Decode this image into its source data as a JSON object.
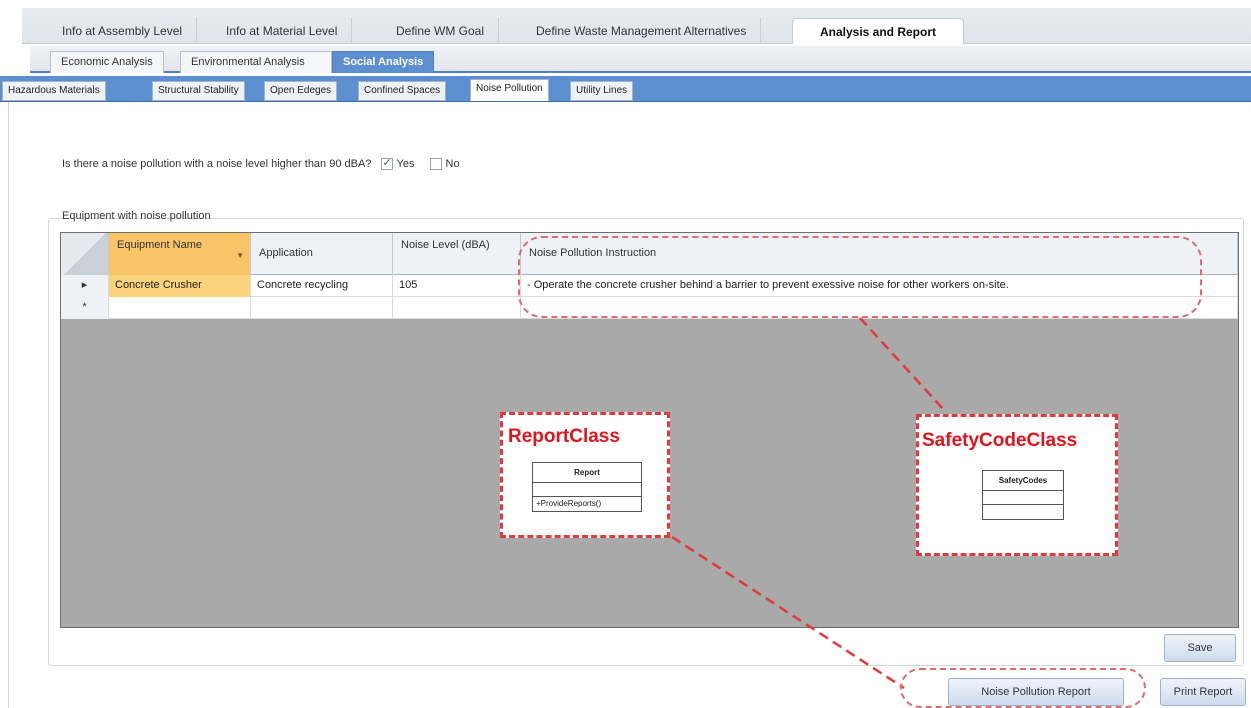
{
  "top_tabs": [
    {
      "label": "Info at Assembly Level"
    },
    {
      "label": "Info at Material Level"
    },
    {
      "label": "Define WM Goal"
    },
    {
      "label": "Define Waste Management Alternatives"
    },
    {
      "label": "Analysis and Report",
      "active": true
    }
  ],
  "analysis_tabs": [
    {
      "label": "Economic Analysis"
    },
    {
      "label": "Environmental Analysis"
    },
    {
      "label": "Social Analysis",
      "active": true
    }
  ],
  "social_tabs": [
    {
      "label": "Hazardous Materials"
    },
    {
      "label": "Structural Stability"
    },
    {
      "label": "Open Edeges"
    },
    {
      "label": "Confined Spaces"
    },
    {
      "label": "Noise Pollution",
      "active": true
    },
    {
      "label": "Utility Lines"
    }
  ],
  "question": {
    "text": "Is there a noise pollution with a noise level higher than 90 dBA?",
    "yes_label": "Yes",
    "yes_checked": true,
    "no_label": "No",
    "no_checked": false
  },
  "group_label": "Equipment with noise pollution",
  "grid": {
    "columns": [
      {
        "label": "Equipment Name"
      },
      {
        "label": "Application"
      },
      {
        "label": "Noise Level (dBA)"
      },
      {
        "label": "Noise Pollution Instruction"
      }
    ],
    "rows": [
      {
        "marker": "▸",
        "equipment": "Concrete Crusher",
        "application": "Concrete recycling",
        "noise_level": "105",
        "instruction": "- Operate the concrete crusher behind a barrier to prevent exessive noise for other workers on-site."
      },
      {
        "marker": "*",
        "equipment": "",
        "application": "",
        "noise_level": "",
        "instruction": ""
      }
    ]
  },
  "annotations": {
    "report_class": {
      "title": "ReportClass",
      "uml_name": "Report",
      "uml_method": "+ProvideReports()"
    },
    "safety_class": {
      "title": "SafetyCodeClass",
      "uml_name": "SafetyCodes"
    },
    "color": "#e0141c"
  },
  "buttons": {
    "save": "Save",
    "noise_report": "Noise Pollution Report",
    "print_report": "Print Report"
  },
  "colors": {
    "accent": "#5b8fd0",
    "selected_cell": "#f8c468"
  }
}
